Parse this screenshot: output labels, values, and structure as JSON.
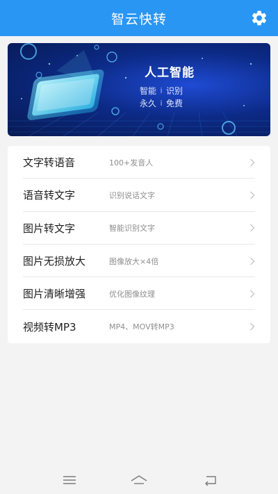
{
  "header": {
    "title": "智云快转",
    "settings_icon": "gear-icon",
    "background": "#2a96f4"
  },
  "banner": {
    "title": "人工智能",
    "line1_left": "智能",
    "line1_sep": "i",
    "line1_right": "识别",
    "line2_left": "永久",
    "line2_sep": "i",
    "line2_right": "免费",
    "image": "smartphone-hologram-illustration"
  },
  "menu": {
    "items": [
      {
        "title": "文字转语音",
        "desc": "100+发音人"
      },
      {
        "title": "语音转文字",
        "desc": "识别说话文字"
      },
      {
        "title": "图片转文字",
        "desc": "智能识别文字"
      },
      {
        "title": "图片无损放大",
        "desc": "图像放大×4倍"
      },
      {
        "title": "图片清晰增强",
        "desc": "优化图像纹理"
      },
      {
        "title": "视频转MP3",
        "desc": "MP4、MOV转MP3"
      }
    ]
  },
  "nav_bar": {
    "menu_icon": "menu-icon",
    "home_icon": "home-icon",
    "back_icon": "back-icon"
  }
}
